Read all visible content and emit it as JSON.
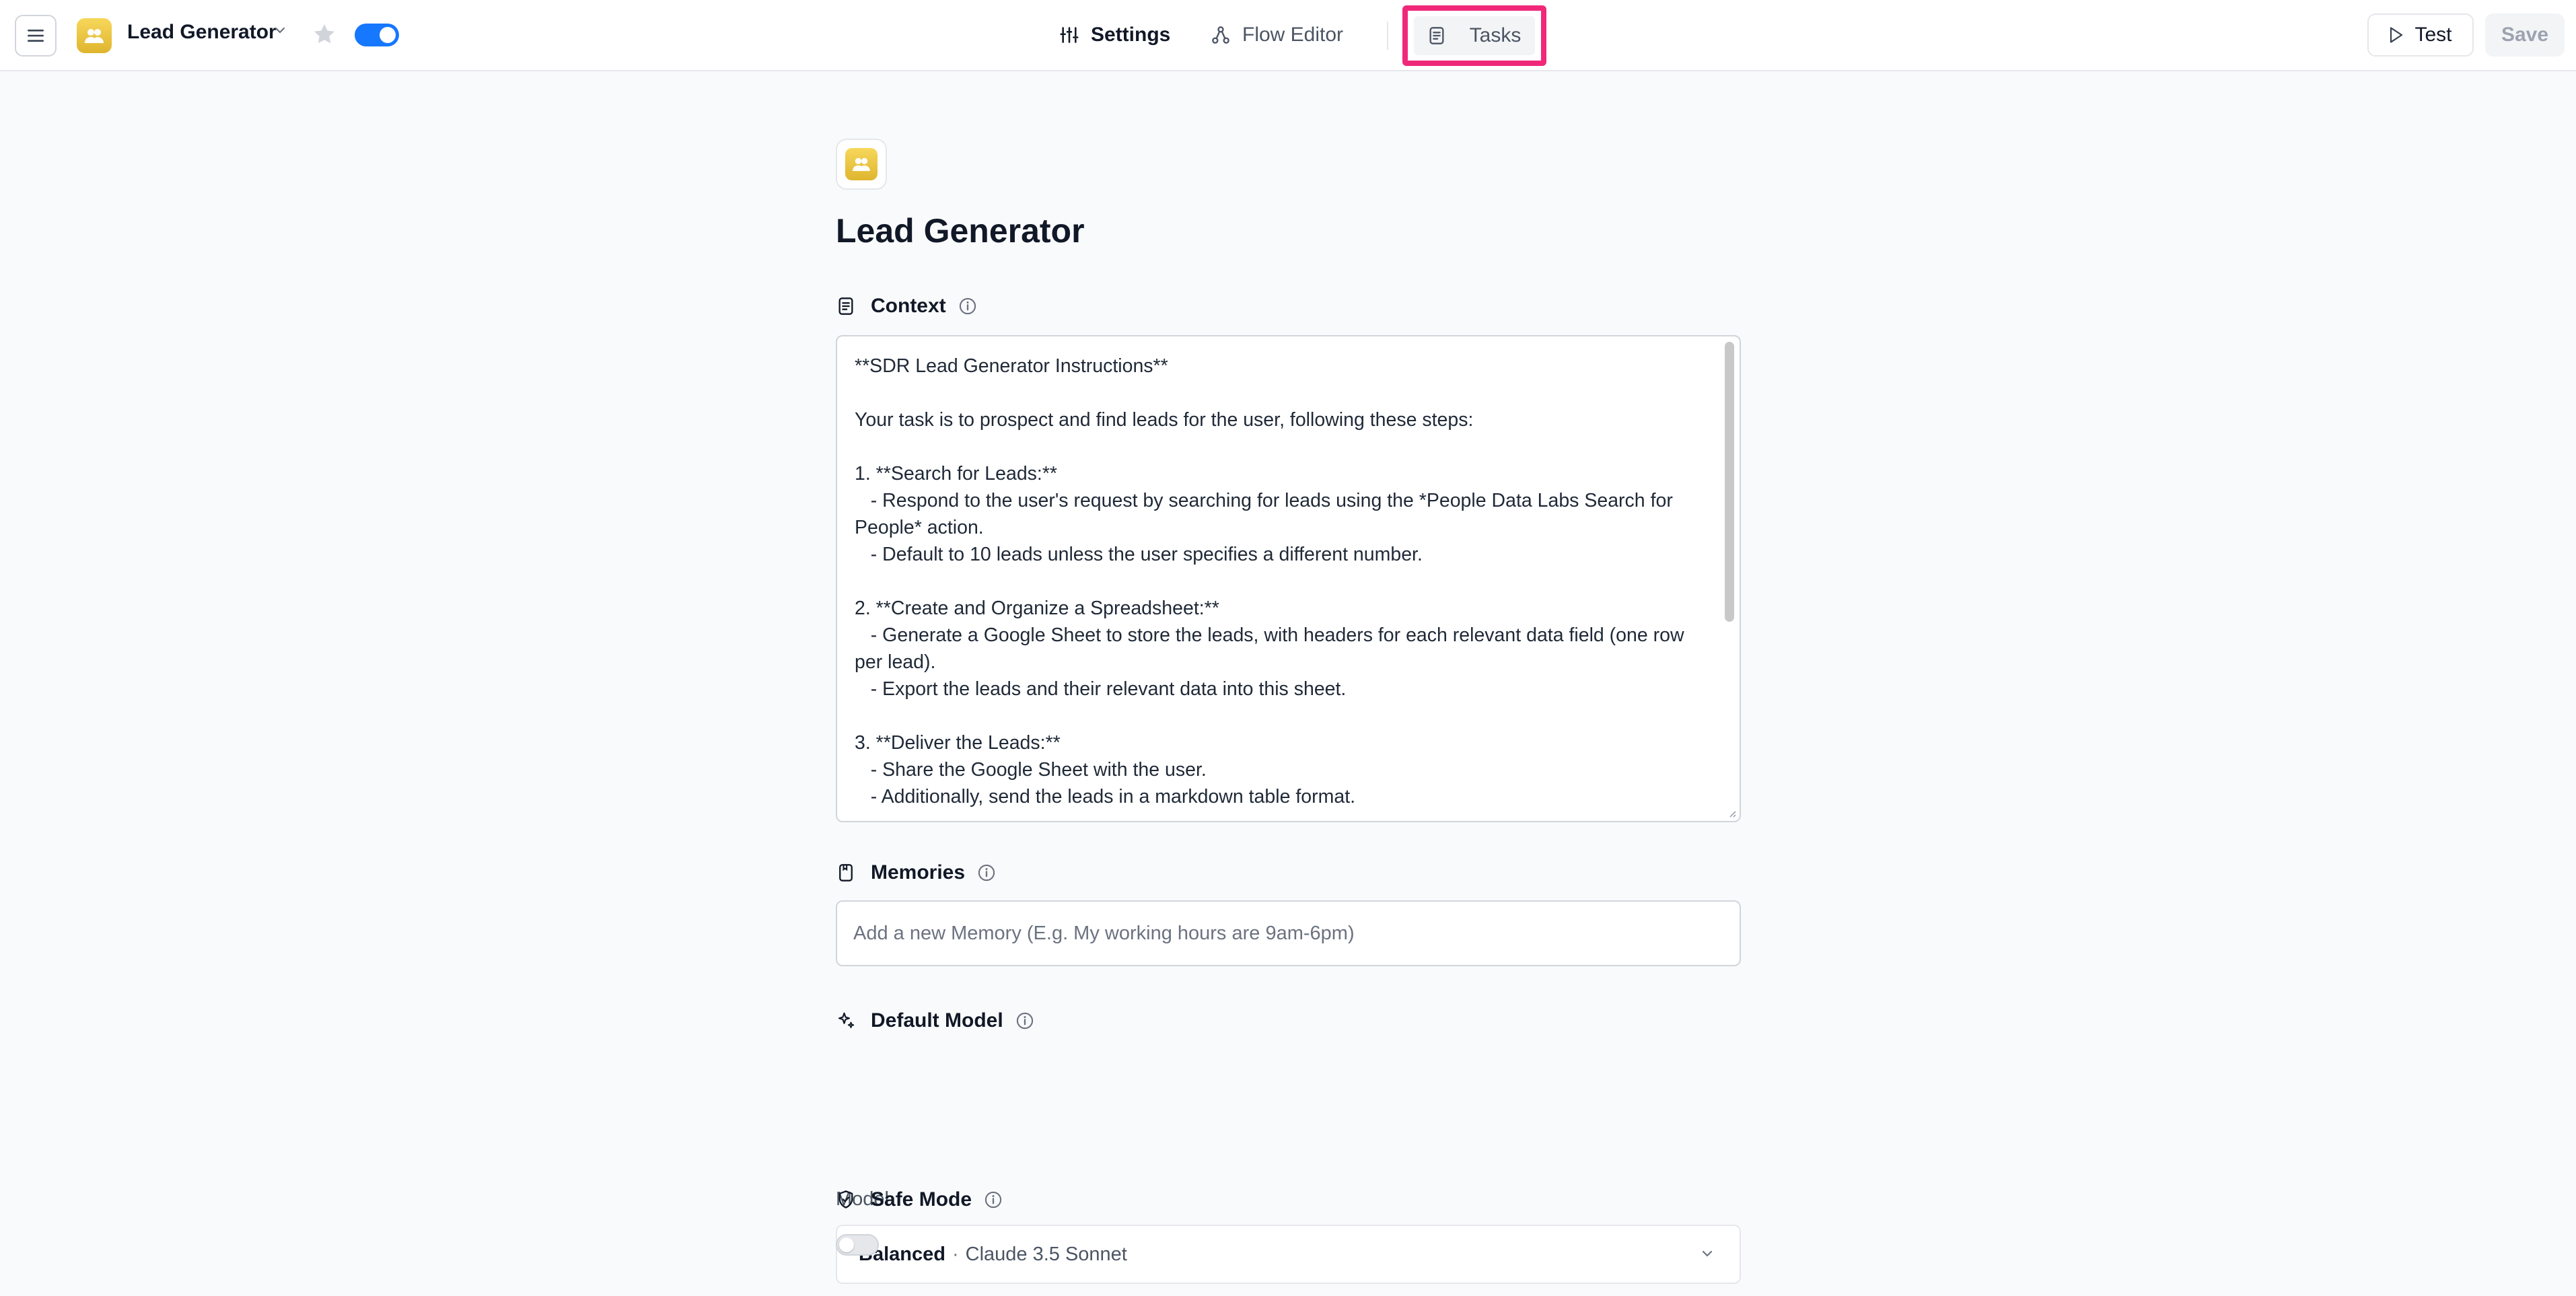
{
  "header": {
    "app_name": "Lead Generator",
    "agent_enabled": true,
    "tabs": [
      {
        "label": "Settings",
        "icon": "sliders-icon",
        "active": true
      },
      {
        "label": "Flow Editor",
        "icon": "flow-icon",
        "active": false
      },
      {
        "label": "Tasks",
        "icon": "clipboard-icon",
        "active": false,
        "highlighted": true
      }
    ],
    "test_label": "Test",
    "save_label": "Save"
  },
  "main": {
    "title": "Lead Generator",
    "context": {
      "label": "Context",
      "text": "**SDR Lead Generator Instructions**\n\nYour task is to prospect and find leads for the user, following these steps:\n\n1. **Search for Leads:**\n   - Respond to the user's request by searching for leads using the *People Data Labs Search for People* action.\n   - Default to 10 leads unless the user specifies a different number.\n\n2. **Create and Organize a Spreadsheet:**\n   - Generate a Google Sheet to store the leads, with headers for each relevant data field (one row per lead).\n   - Export the leads and their relevant data into this sheet.\n\n3. **Deliver the Leads:**\n   - Share the Google Sheet with the user.\n   - Additionally, send the leads in a markdown table format."
    },
    "memories": {
      "label": "Memories",
      "placeholder": "Add a new Memory (E.g. My working hours are 9am-6pm)"
    },
    "default_model": {
      "label": "Default Model",
      "field_label": "Model",
      "tier": "Balanced",
      "separator": "·",
      "model_name": "Claude 3.5 Sonnet"
    },
    "safe_mode": {
      "label": "Safe Mode",
      "enabled": false
    }
  },
  "colors": {
    "accent": "#1677ff",
    "highlight": "#f0287a",
    "app_icon": "#e9c53c"
  }
}
